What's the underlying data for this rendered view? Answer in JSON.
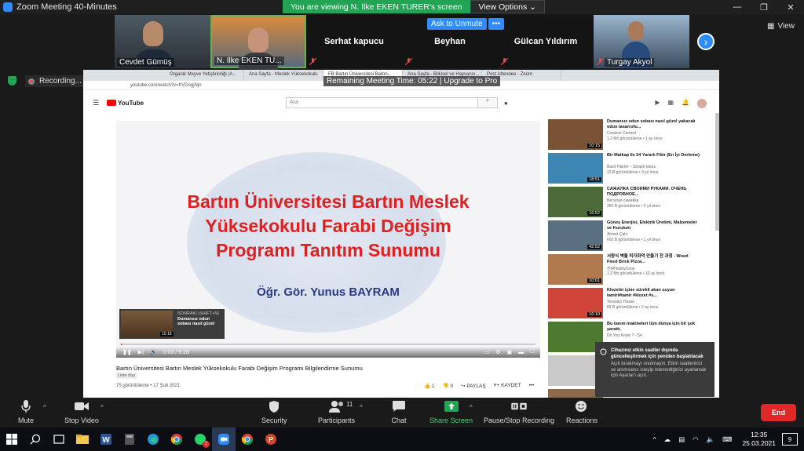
{
  "zoom": {
    "window_title": "Zoom Meeting 40-Minutes",
    "viewing_banner": "You are viewing N. Ilke EKEN TURER's screen",
    "view_options": "View Options",
    "view_label": "View",
    "ask_to_unmute": "Ask to Unmute",
    "more_btn": "•••",
    "recording_label": "Recording...",
    "remaining_meeting_time": "Remaining Meeting Time: 05:22 | Upgrade to Pro",
    "participants": [
      {
        "name": "Cevdet Gümüş"
      },
      {
        "name": "N. Ilke EKEN TU..."
      },
      {
        "name": "Serhat  kapucu"
      },
      {
        "name": "Beyhan"
      },
      {
        "name": "Gülcan Yıldırım"
      },
      {
        "name": "Turgay Akyol"
      }
    ],
    "toolbar": {
      "mute": "Mute",
      "stop_video": "Stop Video",
      "security": "Security",
      "participants": "Participants",
      "participants_count": "11",
      "chat": "Chat",
      "share_screen": "Share Screen",
      "pause_recording": "Pause/Stop Recording",
      "reactions": "Reactions",
      "end": "End"
    }
  },
  "browser": {
    "tabs": [
      "Organik Meyve Yetiştiriciliği (A...",
      "Ana Sayfa - Meslek Yüksekokulu",
      "FB Bartın Üniversitesi Bartın...",
      "Ana Sayfa - Bilkisel ve Hayvancı...",
      "Post Attendee - Zoom"
    ],
    "address": "youtube.com/watch?v=frVDogjNjo"
  },
  "youtube": {
    "search_placeholder": "Ara",
    "notif_count": "9+",
    "slide": {
      "line1": "Bartın Üniversitesi Bartın Meslek",
      "line2": "Yüksekokulu Farabi Değişim",
      "line3": "Programı  Tanıtım Sunumu",
      "author": "Öğr. Gör. Yunus BAYRAM"
    },
    "player": {
      "time": "0:03 / 9:28"
    },
    "next_card": {
      "label": "SONRAKİ (SHIFT+N)",
      "title": "Dumansız odun sobası nasıl güzel",
      "duration": "10:18"
    },
    "video": {
      "title": "Bartın Üniversitesi Bartın Meslek Yüksekokulu Farabi Değişim Programı Bilgilendirme Sunumu",
      "playlist": "Liste dışı",
      "meta": "75 görüntüleme • 17 Şub 2021",
      "likes": "1",
      "dislikes": "0",
      "share": "PAYLAŞ",
      "save": "KAYDET"
    },
    "suggestions": [
      {
        "title": "Dumansız odun sobası nasıl güzel yakacak odun tasarrufu...",
        "channel": "Creative Cement",
        "views": "1,2 Mn görüntüleme • 1 ay önce",
        "duration": "10:15",
        "color": "#7a5236"
      },
      {
        "title": "Bir Matkap ile 54 Yararlı Fikir (En İyi Derleme)",
        "channel": "Basit Fikirler – Simple Ideas",
        "views": "33 B görüntüleme • 3 yıl önce",
        "duration": "18:51",
        "color": "#3d86b4"
      },
      {
        "title": "САЖАЛКА СВОИМИ РУКАМИ. ОЧЕНЬ ПОДРОБНОЕ...",
        "channel": "Веселая семейка",
        "views": "360 B görüntüleme • 3 yıl önce",
        "duration": "16:52",
        "color": "#4d6b3a"
      },
      {
        "title": "Güneş Enerjisi, Elektrik Üretimi, Malzemeler ve Kurulum",
        "channel": "Ahmet Çalır",
        "views": "602 B görüntüleme • 1 yıl önce",
        "duration": "42:52",
        "color": "#5a6f80"
      },
      {
        "title": "서양식 벽돌 피자화덕 만들기 전 과정 - Wood Fired Brick Pizza...",
        "channel": "한량HobbyCook",
        "views": "1,2 Mn görüntüleme • 10 ay önce",
        "duration": "10:01",
        "color": "#b07a4e"
      },
      {
        "title": "Klozetin içine sürekli akan suyun tamiri#tamir #klozet #s...",
        "channel": "Tesisatçı Hasan",
        "views": "89 B görüntüleme • 2 ay önce",
        "duration": "16:10",
        "color": "#d0443a"
      },
      {
        "title": "Bu tanım makineleri tüm dünya için bir şok yarattı.",
        "channel": "Do You Know ? · S4",
        "views": "",
        "duration": "",
        "color": "#4e7a30"
      },
      {
        "title": "",
        "channel": "",
        "views": "",
        "duration": "",
        "color": "#c9c9c9"
      },
      {
        "title": "",
        "channel": "",
        "views": "",
        "duration": "",
        "color": "#8a6a4a"
      }
    ]
  },
  "notification": {
    "title": "Cihazınız etkin saatler dışında güncelleştirmek için yeniden başlatılacak",
    "body": "Açık bırakmayı unutmayın. Etkin saatlerinizi ve anımsatıcı isteyip istemediğinizi ayarlamak için Ayarlar'ı açın."
  },
  "taskbar": {
    "time": "12:35",
    "date": "25.03.2021",
    "notif_count": "9",
    "whatsapp_badge": "2"
  }
}
